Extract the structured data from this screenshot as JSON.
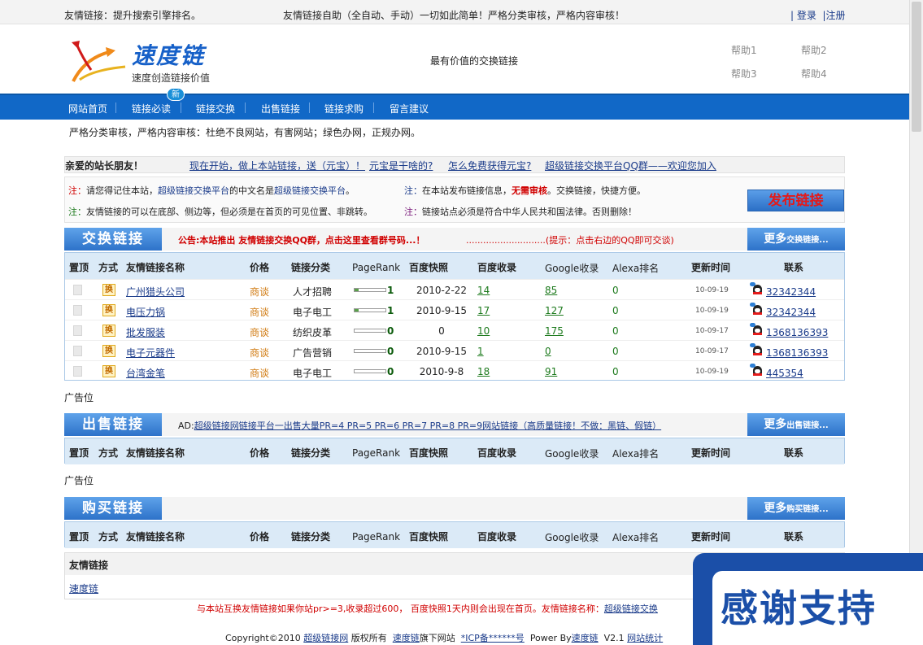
{
  "topbar": {
    "left": "友情链接：提升搜索引擎排名。",
    "middle": "友情链接自助（全自动、手动）一切如此简单！严格分类审核，严格内容审核！",
    "login": "登录",
    "register": "注册"
  },
  "header": {
    "logo_title": "速度链",
    "logo_sub": "速度创造链接价值",
    "tagline": "最有价值的交换链接",
    "help": [
      "帮助1",
      "帮助2",
      "帮助3",
      "帮助4"
    ]
  },
  "nav": {
    "items": [
      "网站首页",
      "链接必读",
      "链接交换",
      "出售链接",
      "链接求购",
      "留言建议"
    ],
    "badge": "新"
  },
  "notice": "严格分类审核，严格内容审核：杜绝不良网站，有害网站；绿色办网，正规办网。",
  "friendbar": {
    "greeting": "亲爱的站长朋友！",
    "links": [
      "现在开始，做上本站链接，送（元宝）！",
      "元宝是干啥的?",
      "怎么免费获得元宝?",
      "超级链接交换平台QQ群——欢迎您加入"
    ]
  },
  "notes": {
    "prefix": "注：",
    "n1_a": "请您得记住本站，",
    "n1_b": "超级链接交换平台",
    "n1_c": "的中文名是",
    "n1_d": "超级链接交换平台",
    "n1_e": "。",
    "n2_a": "在本站发布链接信息，",
    "n2_b": "无需审核",
    "n2_c": "。交换链接，快捷方便。",
    "n3": "友情链接的可以在底部、侧边等，但必须是在首页的可见位置、非跳转。",
    "n4": "链接站点必须是符合中华人民共和国法律。否则删除！",
    "publish": "发布链接"
  },
  "exchange": {
    "title": "交换链接",
    "announce": "公告:本站推出  友情链接交换QQ群，点击这里查看群号码...！",
    "dots": "............................(提示：点击右边的QQ即可交谈)",
    "more": "更多",
    "more_small": "交换链接..."
  },
  "columns": [
    "置顶",
    "方式",
    "友情链接名称",
    "价格",
    "链接分类",
    "PageRank",
    "百度快照",
    "百度收录",
    "Google收录",
    "Alexa排名",
    "更新时间",
    "联系"
  ],
  "rows": [
    {
      "icon": "换",
      "name": "广州猎头公司",
      "price": "商谈",
      "cat": "人才招聘",
      "pr": "1",
      "pr_fill": 0.12,
      "snapshot": "2010-2-22",
      "baidu": "14",
      "google": "85",
      "alexa": "0",
      "time": "10-09-19",
      "qq": "32342344"
    },
    {
      "icon": "换",
      "name": "电压力锅",
      "price": "商谈",
      "cat": "电子电工",
      "pr": "1",
      "pr_fill": 0.12,
      "snapshot": "2010-9-15",
      "baidu": "17",
      "google": "127",
      "alexa": "0",
      "time": "10-09-19",
      "qq": "32342344"
    },
    {
      "icon": "换",
      "name": "批发服装",
      "price": "商谈",
      "cat": "纺织皮革",
      "pr": "0",
      "pr_fill": 0,
      "snapshot": "0",
      "baidu": "10",
      "google": "175",
      "alexa": "0",
      "time": "10-09-17",
      "qq": "1368136393"
    },
    {
      "icon": "换",
      "name": "电子元器件",
      "price": "商谈",
      "cat": "广告营销",
      "pr": "0",
      "pr_fill": 0,
      "snapshot": "2010-9-15",
      "baidu": "1",
      "google": "0",
      "alexa": "0",
      "time": "10-09-17",
      "qq": "1368136393"
    },
    {
      "icon": "换",
      "name": "台湾金笔",
      "price": "商谈",
      "cat": "电子电工",
      "pr": "0",
      "pr_fill": 0,
      "snapshot": "2010-9-8",
      "baidu": "18",
      "google": "91",
      "alexa": "0",
      "time": "10-09-19",
      "qq": "445354"
    }
  ],
  "ad_label": "广告位",
  "sell": {
    "title": "出售链接",
    "ad": "AD:",
    "ad_link": "超级链接网链接平台一出售大量PR=4 PR=5 PR=6 PR=7 PR=8 PR=9网站链接（高质量链接！不做：黑链、假链）",
    "more": "更多",
    "more_small": "出售链接..."
  },
  "buy": {
    "title": "购买链接",
    "more": "更多",
    "more_small": "购买链接..."
  },
  "friend_links": {
    "title": "友情链接",
    "item": "速度链"
  },
  "footer": {
    "line1": "与本站互换友情链接如果你站pr>=3,收录超过600， 百度快照1天内则会出现在首页。友情链接名称：",
    "line1_link": "超级链接交换",
    "copyright": "Copyright©2010",
    "site": "超级链接网",
    "rights": "版权所有",
    "brand": "速度链",
    "brand_tail": "旗下网站",
    "icp": "*ICP备******号",
    "power": "Power By",
    "power_link": "速度链",
    "version": "V2.1",
    "stats": "网站统计"
  },
  "overlay": {
    "text": "感谢支持"
  }
}
